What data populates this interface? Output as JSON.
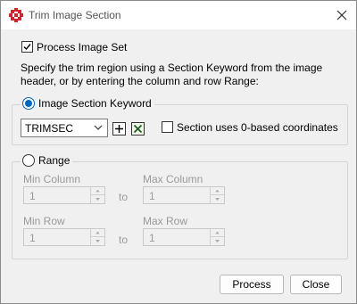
{
  "window": {
    "title": "Trim Image Section",
    "app_icon": "grid-app-icon",
    "close_icon": "close-icon"
  },
  "process_image_set": {
    "label": "Process Image Set",
    "checked": true
  },
  "instructions": "Specify the trim region using a Section Keyword from the image header, or by entering the column and row Range:",
  "section_keyword_group": {
    "radio_label": "Image Section Keyword",
    "selected": true,
    "keyword_value": "TRIMSEC",
    "add_icon": "plus-icon",
    "remove_icon": "x-box-icon",
    "zero_based_label": "Section uses 0-based coordinates",
    "zero_based_checked": false
  },
  "range_group": {
    "radio_label": "Range",
    "selected": false,
    "min_column_label": "Min Column",
    "min_column_value": "1",
    "max_column_label": "Max Column",
    "max_column_value": "1",
    "min_row_label": "Min Row",
    "min_row_value": "1",
    "max_row_label": "Max Row",
    "max_row_value": "1",
    "to_label_1": "to",
    "to_label_2": "to"
  },
  "buttons": {
    "process": "Process",
    "close": "Close"
  }
}
